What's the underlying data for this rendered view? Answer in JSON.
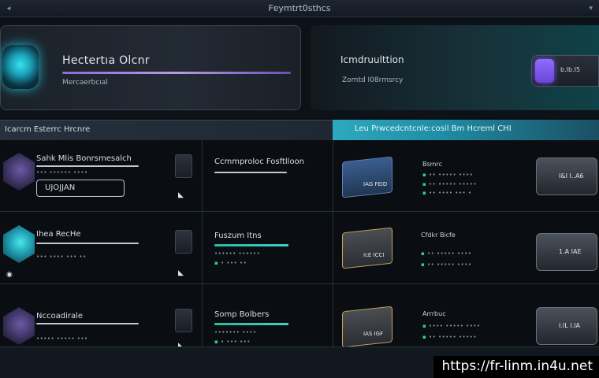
{
  "window": {
    "title": "Fɐymtrt0sthcs"
  },
  "hero_left": {
    "title": "Hectertıa Olcnr",
    "subtitle": "Mercəerbcıal"
  },
  "hero_right": {
    "title": "Icmdruulttion",
    "subtitle": "Zomtd I08rmsrcy",
    "toggle_label": "b.Ib.I5"
  },
  "header": {
    "left": "Icarcm Esterrc Hrcnre",
    "right": "Leu Prwcedcntcnle:cosil Bm Hcreml CHI"
  },
  "rows": [
    {
      "col1_title": "Sahk Mlis Bonrsmesalch",
      "col1_dots": "••• •••••• ••••",
      "col1_button": "UJOJJAN",
      "col2_title": "Ccmmproloc Fosftlloon",
      "col3_label": "Bsmrc",
      "col3_dots_a": "•• ••••• ••••",
      "col3_dots_b": "•• ••••• •••••",
      "col3_dots_c": "•• •••• ••• •",
      "tile_label": "IAG FEID",
      "box_label": "I&I I..A6"
    },
    {
      "col1_title": "Ihea RecHe",
      "col1_dots": "••• •••• ••• ••",
      "col2_title": "Fuszum Itns",
      "col2_dots_a": "•••••• ••••••",
      "col2_dots_b": "• ••• ••",
      "col3_label": "Cfdkr Bicfe",
      "col3_dots_a": "•• ••••• ••••",
      "col3_dots_b": "•• ••••• ••••",
      "tile_label": "IcE ICCI",
      "box_label": "1.A IAE"
    },
    {
      "col1_title": "Nccoadirale",
      "col1_dots": "••••• ••••• •••",
      "col2_title": "Somp Bolbers",
      "col2_dots_a": "••••••• ••••",
      "col2_dots_b": "• ••• •••",
      "col3_label": "Arrrbuc",
      "col3_dots_a": "•••• ••••• ••••",
      "col3_dots_b": "•• ••••• •••••",
      "tile_label": "IAS IGF",
      "box_label": "I.IL I.IA"
    }
  ],
  "watermark": "https://fr-linm.in4u.net",
  "colors": {
    "accent_teal": "#2da9bf",
    "accent_purple": "#7a55e8",
    "success_green": "#2ed47a"
  }
}
